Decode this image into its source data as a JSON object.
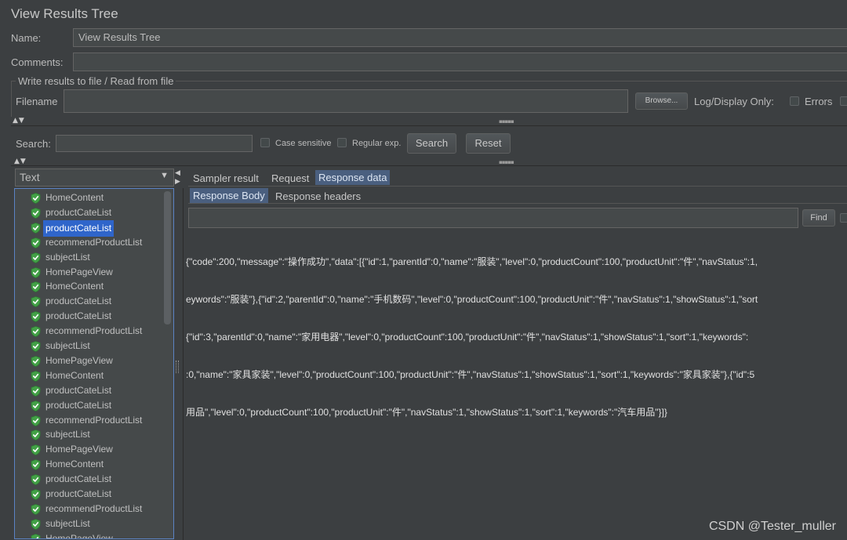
{
  "window": {
    "title": "View Results Tree"
  },
  "form": {
    "name_label": "Name:",
    "name_value": "View Results Tree",
    "comments_label": "Comments:",
    "comments_value": "",
    "file_section_label": "Write results to file / Read from file",
    "filename_label": "Filename",
    "filename_value": "",
    "browse_label": "Browse...",
    "log_display_label": "Log/Display Only:",
    "errors_label": "Errors"
  },
  "search": {
    "label": "Search:",
    "value": "",
    "case_sensitive_label": "Case sensitive",
    "regex_label": "Regular exp.",
    "search_button": "Search",
    "reset_button": "Reset"
  },
  "renderer": {
    "selected": "Text"
  },
  "tree": {
    "selected_index": 2,
    "items": [
      "HomeContent",
      "productCateList",
      "productCateList",
      "recommendProductList",
      "subjectList",
      "HomePageView",
      "HomeContent",
      "productCateList",
      "productCateList",
      "recommendProductList",
      "subjectList",
      "HomePageView",
      "HomeContent",
      "productCateList",
      "productCateList",
      "recommendProductList",
      "subjectList",
      "HomePageView",
      "HomeContent",
      "productCateList",
      "productCateList",
      "recommendProductList",
      "subjectList",
      "HomePageView"
    ]
  },
  "tabs": {
    "sampler_result": "Sampler result",
    "request": "Request",
    "response_data": "Response data",
    "response_body": "Response Body",
    "response_headers": "Response headers"
  },
  "find": {
    "button": "Find",
    "value": ""
  },
  "response": {
    "lines": [
      "{\"code\":200,\"message\":\"操作成功\",\"data\":[{\"id\":1,\"parentId\":0,\"name\":\"服装\",\"level\":0,\"productCount\":100,\"productUnit\":\"件\",\"navStatus\":1,",
      "eywords\":\"服装\"},{\"id\":2,\"parentId\":0,\"name\":\"手机数码\",\"level\":0,\"productCount\":100,\"productUnit\":\"件\",\"navStatus\":1,\"showStatus\":1,\"sort",
      "{\"id\":3,\"parentId\":0,\"name\":\"家用电器\",\"level\":0,\"productCount\":100,\"productUnit\":\"件\",\"navStatus\":1,\"showStatus\":1,\"sort\":1,\"keywords\":",
      ":0,\"name\":\"家具家装\",\"level\":0,\"productCount\":100,\"productUnit\":\"件\",\"navStatus\":1,\"showStatus\":1,\"sort\":1,\"keywords\":\"家具家装\"},{\"id\":5",
      "用品\",\"level\":0,\"productCount\":100,\"productUnit\":\"件\",\"navStatus\":1,\"showStatus\":1,\"sort\":1,\"keywords\":\"汽车用品\"}]}"
    ]
  },
  "watermark": "CSDN @Tester_muller",
  "colors": {
    "background": "#3c3f41",
    "selection": "#2f65ca",
    "success_shield": "#4caf50"
  },
  "icons": {
    "tree_item": "shield-check-icon"
  }
}
